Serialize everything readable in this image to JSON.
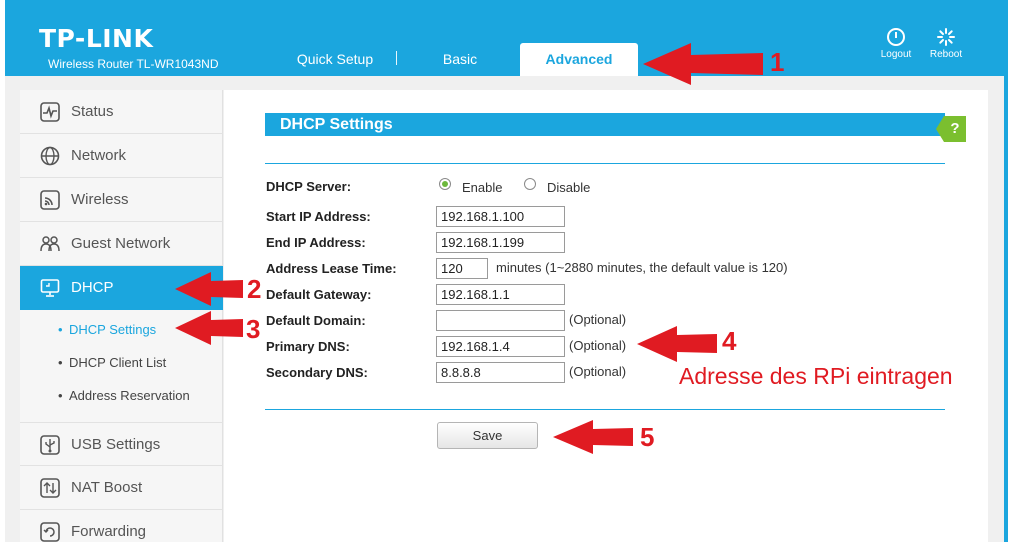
{
  "header": {
    "brand": "TP-LINK",
    "model": "Wireless Router TL-WR1043ND",
    "tabs": {
      "quick_setup": "Quick Setup",
      "basic": "Basic",
      "advanced": "Advanced"
    },
    "logout_label": "Logout",
    "reboot_label": "Reboot",
    "accent_color": "#1ba6de"
  },
  "sidebar": {
    "items": [
      {
        "label": "Status",
        "icon": "status-icon"
      },
      {
        "label": "Network",
        "icon": "globe-icon"
      },
      {
        "label": "Wireless",
        "icon": "wireless-icon"
      },
      {
        "label": "Guest Network",
        "icon": "guest-network-icon"
      },
      {
        "label": "DHCP",
        "icon": "monitor-icon",
        "active": true
      },
      {
        "label": "USB Settings",
        "icon": "usb-icon"
      },
      {
        "label": "NAT Boost",
        "icon": "nat-boost-icon"
      },
      {
        "label": "Forwarding",
        "icon": "forwarding-icon"
      }
    ],
    "dhcp_sub": [
      {
        "label": "DHCP Settings",
        "active": true
      },
      {
        "label": "DHCP Client List"
      },
      {
        "label": "Address Reservation"
      }
    ]
  },
  "main": {
    "section_title": "DHCP Settings",
    "help_label": "?",
    "form": {
      "dhcp_server_label": "DHCP Server:",
      "enable_label": "Enable",
      "disable_label": "Disable",
      "dhcp_server_value": "Enable",
      "start_ip_label": "Start IP Address:",
      "start_ip_value": "192.168.1.100",
      "end_ip_label": "End IP Address:",
      "end_ip_value": "192.168.1.199",
      "lease_label": "Address Lease Time:",
      "lease_value": "120",
      "lease_note": "minutes (1~2880 minutes, the default value is 120)",
      "gateway_label": "Default Gateway:",
      "gateway_value": "192.168.1.1",
      "domain_label": "Default Domain:",
      "domain_value": "",
      "primary_dns_label": "Primary DNS:",
      "primary_dns_value": "192.168.1.4",
      "secondary_dns_label": "Secondary DNS:",
      "secondary_dns_value": "8.8.8.8",
      "optional_note": "(Optional)"
    },
    "save_label": "Save"
  },
  "annotations": {
    "n1": "1",
    "n2": "2",
    "n3": "3",
    "n4": "4",
    "n5": "5",
    "note": "Adresse des RPi eintragen",
    "color": "#e01b22"
  }
}
